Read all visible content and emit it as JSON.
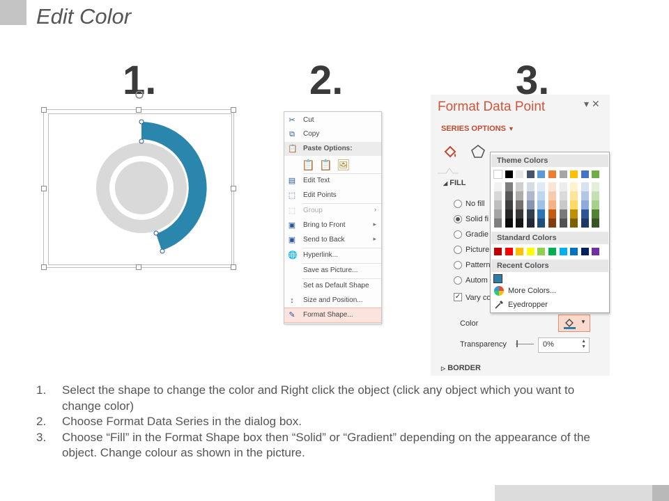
{
  "page": {
    "title": "Edit Color"
  },
  "steps": [
    "1.",
    "2.",
    "3."
  ],
  "context_menu": {
    "items": [
      {
        "label": "Cut",
        "icon": "scissors-icon",
        "glyph": "✂"
      },
      {
        "label": "Copy",
        "icon": "copy-icon",
        "glyph": "⧉"
      },
      {
        "label": "Paste Options:",
        "icon": "clipboard-icon",
        "glyph": "📋"
      },
      {
        "label": "Edit Text",
        "icon": "text-box-icon",
        "glyph": "▤"
      },
      {
        "label": "Edit Points",
        "icon": "edit-points-icon",
        "glyph": "⬚"
      },
      {
        "label": "Group",
        "icon": "group-icon",
        "glyph": "⬚",
        "disabled": true
      },
      {
        "label": "Bring to Front",
        "icon": "bring-front-icon",
        "glyph": "▣"
      },
      {
        "label": "Send to Back",
        "icon": "send-back-icon",
        "glyph": "▣"
      },
      {
        "label": "Hyperlink...",
        "icon": "hyperlink-icon",
        "glyph": "🌐"
      },
      {
        "label": "Save as Picture...",
        "icon": "",
        "glyph": ""
      },
      {
        "label": "Set as Default Shape",
        "icon": "",
        "glyph": ""
      },
      {
        "label": "Size and Position...",
        "icon": "size-position-icon",
        "glyph": "↕"
      },
      {
        "label": "Format Shape...",
        "icon": "format-shape-icon",
        "glyph": "✎"
      }
    ]
  },
  "format_pane": {
    "title": "Format Data Point",
    "series_options": "SERIES OPTIONS",
    "fill_section": "FILL",
    "fill_options": [
      "No fill",
      "Solid fi",
      "Gradie",
      "Picture",
      "Pattern",
      "Autom"
    ],
    "vary_colors": "Vary co",
    "color_label": "Color",
    "transparency_label": "Transparency",
    "transparency_value": "0%",
    "border_section": "BORDER"
  },
  "palette": {
    "theme_header": "Theme Colors",
    "standard_header": "Standard Colors",
    "recent_header": "Recent Colors",
    "more_colors": "More Colors...",
    "eyedropper": "Eyedropper",
    "theme_top": [
      "#FFFFFF",
      "#000000",
      "#E7E6E6",
      "#44546A",
      "#5B9BD5",
      "#ED7D31",
      "#A5A5A5",
      "#FFC000",
      "#4472C4",
      "#70AD47"
    ],
    "theme_shades": [
      [
        "#F2F2F2",
        "#7F7F7F",
        "#D0CECE",
        "#D6DCE4",
        "#DEEBF6",
        "#FBE5D5",
        "#EDEDED",
        "#FFF2CC",
        "#D9E2F3",
        "#E2EFD9"
      ],
      [
        "#D8D8D8",
        "#595959",
        "#AEABAB",
        "#ADB9CA",
        "#BDD7EE",
        "#F7CBAC",
        "#DBDBDB",
        "#FEE599",
        "#B4C6E7",
        "#C5E0B3"
      ],
      [
        "#BFBFBF",
        "#3F3F3F",
        "#757070",
        "#8496B0",
        "#9CC3E5",
        "#F4B183",
        "#C9C9C9",
        "#FFD965",
        "#8EAADB",
        "#A8D08D"
      ],
      [
        "#A5A5A5",
        "#262626",
        "#3A3838",
        "#323F4F",
        "#2E75B5",
        "#C55A11",
        "#7B7B7B",
        "#BF9000",
        "#2F5496",
        "#538135"
      ],
      [
        "#7F7F7F",
        "#0C0C0C",
        "#171616",
        "#222A35",
        "#1E4E79",
        "#833C0B",
        "#525252",
        "#7F6000",
        "#1F3864",
        "#375623"
      ]
    ],
    "standard": [
      "#C00000",
      "#FF0000",
      "#FFC000",
      "#FFFF00",
      "#92D050",
      "#00B050",
      "#00B0F0",
      "#0070C0",
      "#002060",
      "#7030A0"
    ],
    "recent": [
      "#2E7CA8"
    ]
  },
  "chart_colors": {
    "accent": "#2A86AC",
    "ring": "#D9D9D9"
  },
  "instructions": [
    {
      "num": "1.",
      "text": "Select the shape to change the color and Right click the object (click any object which you want to change color)"
    },
    {
      "num": "2.",
      "text": "Choose Format Data Series in the dialog box."
    },
    {
      "num": "3.",
      "text": "Choose “Fill” in the Format Shape box then “Solid” or “Gradient” depending on the appearance of the object. Change colour as shown in the picture."
    }
  ]
}
